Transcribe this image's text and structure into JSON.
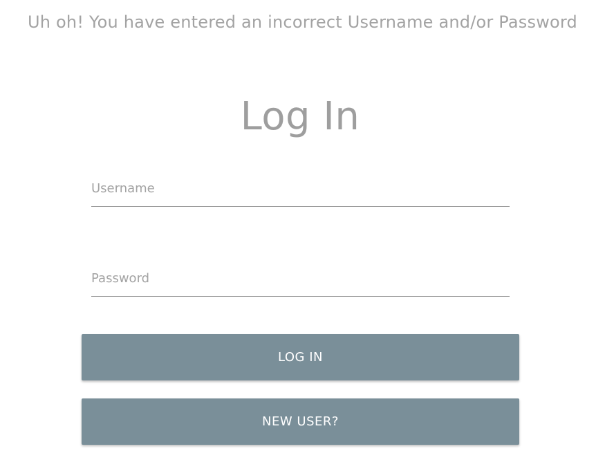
{
  "error": {
    "message": "Uh oh! You have entered an incorrect Username and/or Password"
  },
  "form": {
    "title": "Log In",
    "username": {
      "placeholder": "Username",
      "value": ""
    },
    "password": {
      "placeholder": "Password",
      "value": ""
    },
    "login_label": "LOG IN",
    "new_user_label": "NEW USER?"
  },
  "colors": {
    "button": "#7a8f99",
    "text_muted": "#a3a3a3"
  }
}
